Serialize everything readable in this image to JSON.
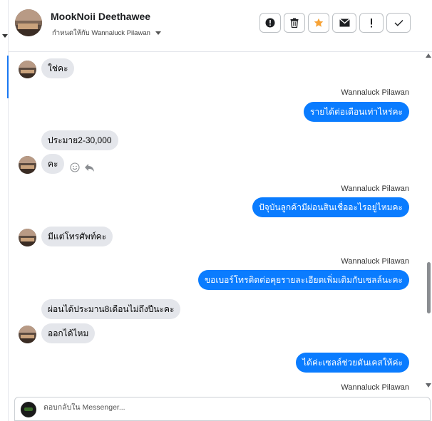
{
  "header": {
    "contact_name": "MookNoii Deethawee",
    "assign_text": "กำหนดให้กับ Wannaluck Pilawan",
    "actions": [
      {
        "name": "exclamation-circle-icon"
      },
      {
        "name": "trash-icon"
      },
      {
        "name": "star-icon",
        "color": "#f7a234"
      },
      {
        "name": "envelope-icon"
      },
      {
        "name": "exclamation-icon"
      },
      {
        "name": "check-icon"
      }
    ]
  },
  "messages": [
    {
      "dir": "in",
      "text": "ใช่คะ"
    },
    {
      "dir": "out",
      "sender": "Wannaluck Pilawan",
      "text": "รายได้ต่อเดือนเท่าไหร่คะ"
    },
    {
      "dir": "in",
      "text": "ประมาย2-30,000"
    },
    {
      "dir": "in",
      "text": "คะ"
    },
    {
      "dir": "out",
      "sender": "Wannaluck Pilawan",
      "text": "ปัจุบันลูกค้ามีผ่อนสินเชื่ออะไรอยู่ไหมคะ"
    },
    {
      "dir": "in",
      "text": "มีแต่โทรศัพท์คะ"
    },
    {
      "dir": "out",
      "sender": "Wannaluck Pilawan",
      "text": "ขอเบอร์โทรติดต่อคุยรายละเอียดเพิ่มเติมกับเซลล์นะคะ"
    },
    {
      "dir": "in",
      "text": "ผ่อนได้ประมาน8เดือนไม่ถึงปีนะคะ"
    },
    {
      "dir": "in",
      "text": "ออกได้ไหม"
    },
    {
      "dir": "out",
      "text": "ได้ค่ะเซลล์ช่วยดันเคสให้ค่ะ"
    },
    {
      "dir": "out",
      "sender": "Wannaluck Pilawan",
      "text": ""
    }
  ],
  "composer": {
    "placeholder": "ตอบกลับใน Messenger..."
  },
  "colors": {
    "outgoing_bubble": "#0a7cff",
    "incoming_bubble": "#e4e6eb",
    "star": "#f7a234"
  }
}
